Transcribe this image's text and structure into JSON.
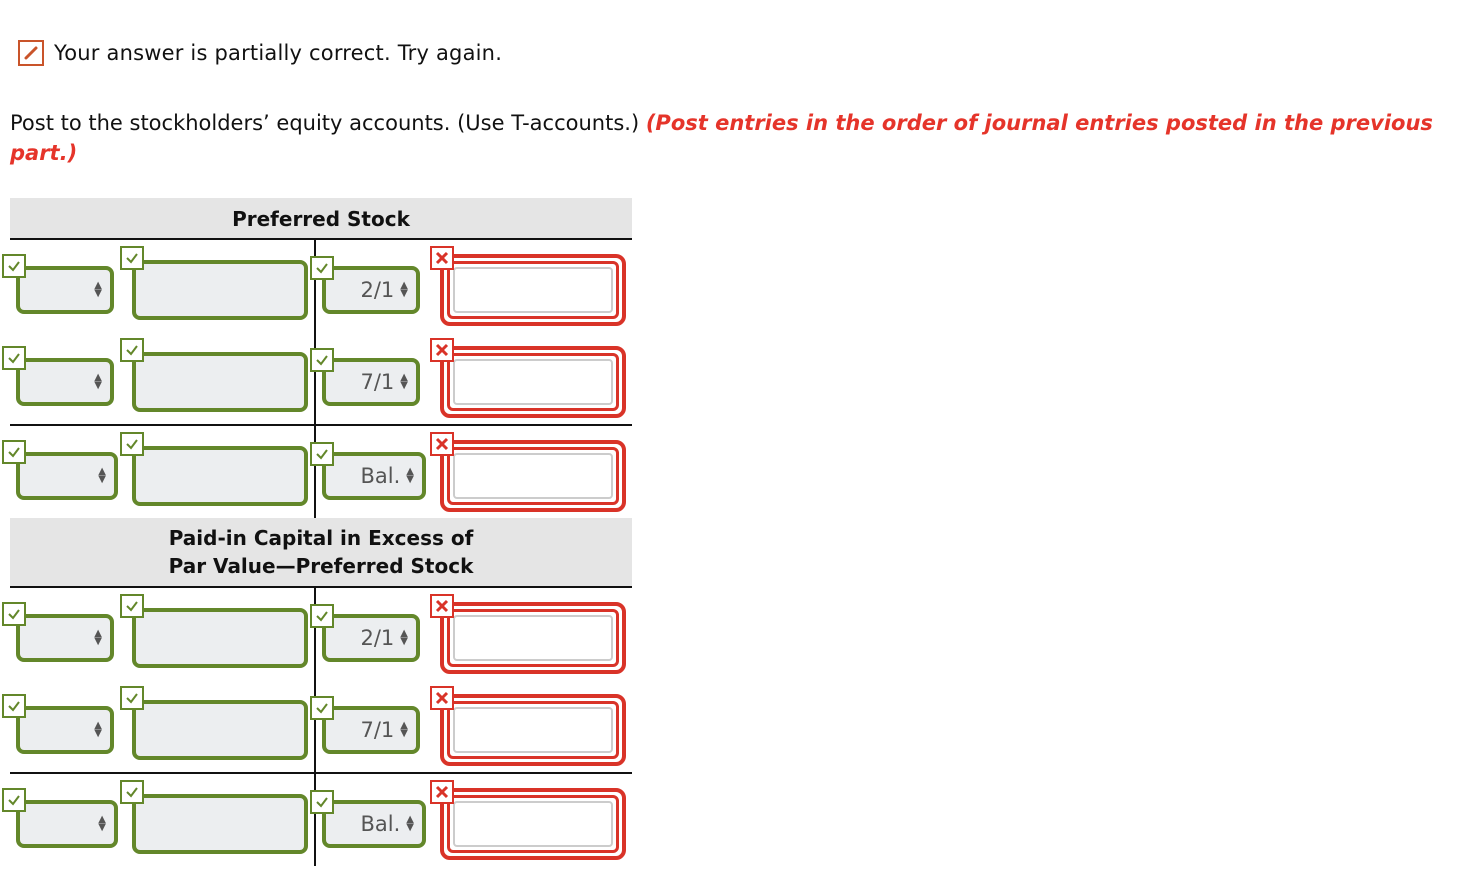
{
  "feedback": {
    "icon": "pencil-icon",
    "text": "Your answer is partially correct.  Try again."
  },
  "instructions": {
    "main": "Post to the stockholders’ equity accounts. (Use T-accounts.) ",
    "emphasis": "(Post entries in the order of journal entries posted in the previous part.)"
  },
  "status_icons": {
    "correct": "checkmark-icon",
    "incorrect": "x-icon"
  },
  "colors": {
    "correct": "#63872a",
    "incorrect": "#d93328",
    "instruction_red": "#e5342a"
  },
  "accounts": [
    {
      "title": "Preferred Stock",
      "rows": [
        {
          "debit_date": "",
          "debit_amount": "",
          "credit_date": "2/1",
          "credit_amount": "",
          "debit_date_status": "correct",
          "debit_amount_status": "correct",
          "credit_date_status": "correct",
          "credit_amount_status": "incorrect"
        },
        {
          "debit_date": "",
          "debit_amount": "",
          "credit_date": "7/1",
          "credit_amount": "",
          "debit_date_status": "correct",
          "debit_amount_status": "correct",
          "credit_date_status": "correct",
          "credit_amount_status": "incorrect"
        },
        {
          "debit_date": "",
          "debit_amount": "",
          "credit_date": "Bal.",
          "credit_amount": "",
          "debit_date_status": "correct",
          "debit_amount_status": "correct",
          "credit_date_status": "correct",
          "credit_amount_status": "incorrect"
        }
      ]
    },
    {
      "title": "Paid-in Capital in Excess of Par Value—Preferred Stock",
      "title_line1": "Paid-in Capital in Excess of",
      "title_line2": "Par Value—Preferred Stock",
      "rows": [
        {
          "debit_date": "",
          "debit_amount": "",
          "credit_date": "2/1",
          "credit_amount": "",
          "debit_date_status": "correct",
          "debit_amount_status": "correct",
          "credit_date_status": "correct",
          "credit_amount_status": "incorrect"
        },
        {
          "debit_date": "",
          "debit_amount": "",
          "credit_date": "7/1",
          "credit_amount": "",
          "debit_date_status": "correct",
          "debit_amount_status": "correct",
          "credit_date_status": "correct",
          "credit_amount_status": "incorrect"
        },
        {
          "debit_date": "",
          "debit_amount": "",
          "credit_date": "Bal.",
          "credit_amount": "",
          "debit_date_status": "correct",
          "debit_amount_status": "correct",
          "credit_date_status": "correct",
          "credit_amount_status": "incorrect"
        }
      ]
    }
  ]
}
